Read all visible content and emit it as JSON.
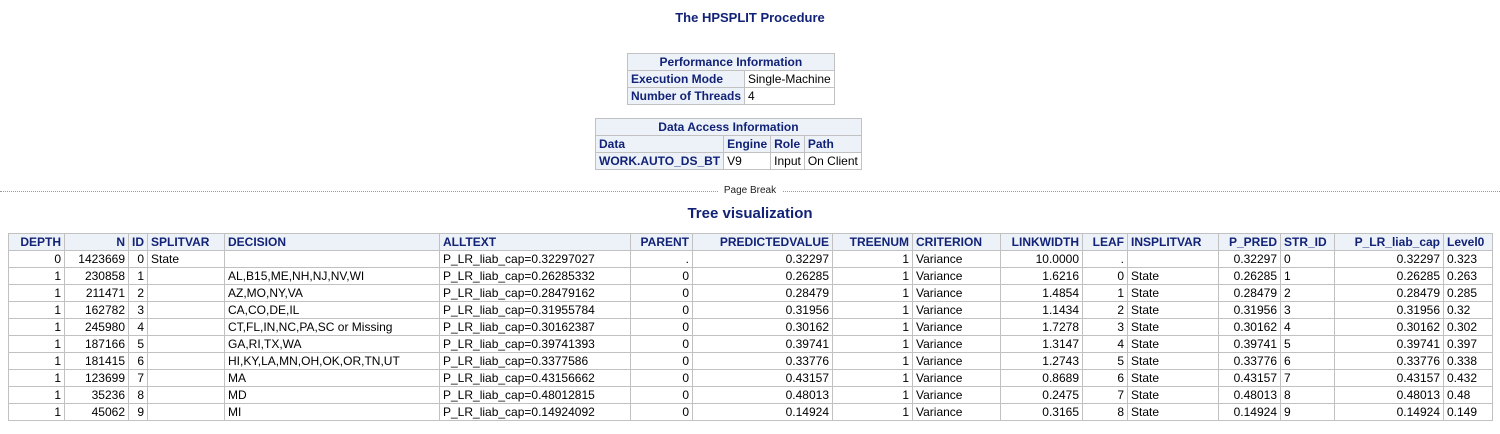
{
  "procedure_title": "The HPSPLIT Procedure",
  "performance": {
    "caption": "Performance Information",
    "rows": [
      {
        "label": "Execution Mode",
        "value": "Single-Machine"
      },
      {
        "label": "Number of Threads",
        "value": "4"
      }
    ]
  },
  "data_access": {
    "caption": "Data Access Information",
    "headers": [
      "Data",
      "Engine",
      "Role",
      "Path"
    ],
    "row": {
      "data": "WORK.AUTO_DS_BT",
      "engine": "V9",
      "role": "Input",
      "path": "On Client"
    }
  },
  "page_break_label": "Page Break",
  "tree_title": "Tree visualization",
  "tree_table": {
    "headers": [
      "DEPTH",
      "N",
      "ID",
      "SPLITVAR",
      "DECISION",
      "ALLTEXT",
      "PARENT",
      "PREDICTEDVALUE",
      "TREENUM",
      "CRITERION",
      "LINKWIDTH",
      "LEAF",
      "INSPLITVAR",
      "P_PRED",
      "STR_ID",
      "P_LR_liab_cap",
      "Level0"
    ],
    "rows": [
      [
        "0",
        "1423669",
        "0",
        "State",
        "",
        "P_LR_liab_cap=0.32297027",
        ".",
        "0.32297",
        "1",
        "Variance",
        "10.0000",
        ".",
        "",
        "0.32297",
        "0",
        "0.32297",
        "0.323"
      ],
      [
        "1",
        "230858",
        "1",
        "",
        "AL,B15,ME,NH,NJ,NV,WI",
        "P_LR_liab_cap=0.26285332",
        "0",
        "0.26285",
        "1",
        "Variance",
        "1.6216",
        "0",
        "State",
        "0.26285",
        "1",
        "0.26285",
        "0.263"
      ],
      [
        "1",
        "211471",
        "2",
        "",
        "AZ,MO,NY,VA",
        "P_LR_liab_cap=0.28479162",
        "0",
        "0.28479",
        "1",
        "Variance",
        "1.4854",
        "1",
        "State",
        "0.28479",
        "2",
        "0.28479",
        "0.285"
      ],
      [
        "1",
        "162782",
        "3",
        "",
        "CA,CO,DE,IL",
        "P_LR_liab_cap=0.31955784",
        "0",
        "0.31956",
        "1",
        "Variance",
        "1.1434",
        "2",
        "State",
        "0.31956",
        "3",
        "0.31956",
        "0.32"
      ],
      [
        "1",
        "245980",
        "4",
        "",
        "CT,FL,IN,NC,PA,SC or Missing",
        "P_LR_liab_cap=0.30162387",
        "0",
        "0.30162",
        "1",
        "Variance",
        "1.7278",
        "3",
        "State",
        "0.30162",
        "4",
        "0.30162",
        "0.302"
      ],
      [
        "1",
        "187166",
        "5",
        "",
        "GA,RI,TX,WA",
        "P_LR_liab_cap=0.39741393",
        "0",
        "0.39741",
        "1",
        "Variance",
        "1.3147",
        "4",
        "State",
        "0.39741",
        "5",
        "0.39741",
        "0.397"
      ],
      [
        "1",
        "181415",
        "6",
        "",
        "HI,KY,LA,MN,OH,OK,OR,TN,UT",
        "P_LR_liab_cap=0.3377586",
        "0",
        "0.33776",
        "1",
        "Variance",
        "1.2743",
        "5",
        "State",
        "0.33776",
        "6",
        "0.33776",
        "0.338"
      ],
      [
        "1",
        "123699",
        "7",
        "",
        "MA",
        "P_LR_liab_cap=0.43156662",
        "0",
        "0.43157",
        "1",
        "Variance",
        "0.8689",
        "6",
        "State",
        "0.43157",
        "7",
        "0.43157",
        "0.432"
      ],
      [
        "1",
        "35236",
        "8",
        "",
        "MD",
        "P_LR_liab_cap=0.48012815",
        "0",
        "0.48013",
        "1",
        "Variance",
        "0.2475",
        "7",
        "State",
        "0.48013",
        "8",
        "0.48013",
        "0.48"
      ],
      [
        "1",
        "45062",
        "9",
        "",
        "MI",
        "P_LR_liab_cap=0.14924092",
        "0",
        "0.14924",
        "1",
        "Variance",
        "0.3165",
        "8",
        "State",
        "0.14924",
        "9",
        "0.14924",
        "0.149"
      ]
    ]
  }
}
